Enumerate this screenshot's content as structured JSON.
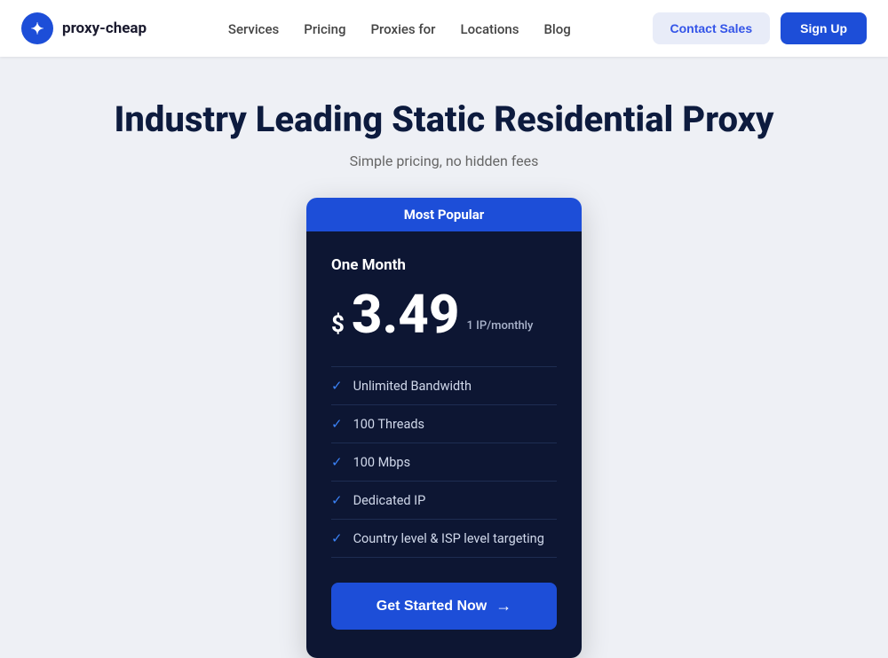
{
  "navbar": {
    "logo_text": "proxy-cheap",
    "links": [
      {
        "label": "Services",
        "href": "#"
      },
      {
        "label": "Pricing",
        "href": "#"
      },
      {
        "label": "Proxies for",
        "href": "#"
      },
      {
        "label": "Locations",
        "href": "#"
      },
      {
        "label": "Blog",
        "href": "#"
      }
    ],
    "contact_label": "Contact Sales",
    "signup_label": "Sign Up"
  },
  "hero": {
    "title_plain": "Industry Leading ",
    "title_bold": "Static Residential Proxy",
    "subtitle": "Simple pricing, no hidden fees"
  },
  "pricing": {
    "badge": "Most Popular",
    "plan": "One Month",
    "price_symbol": "$",
    "price_amount": "3.49",
    "price_period": "1 IP/monthly",
    "features": [
      "Unlimited Bandwidth",
      "100 Threads",
      "100 Mbps",
      "Dedicated IP",
      "Country level & ISP level targeting"
    ],
    "cta_label": "Get Started Now"
  }
}
